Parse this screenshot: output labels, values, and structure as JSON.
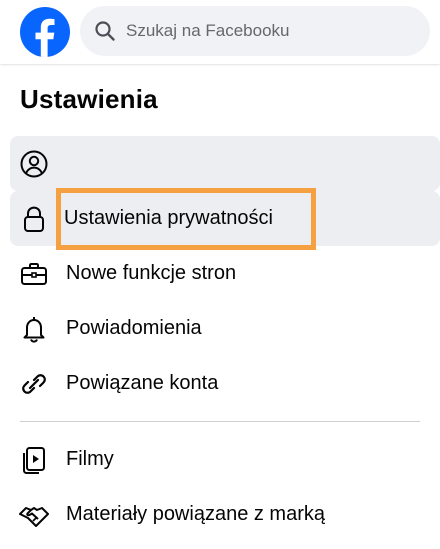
{
  "header": {
    "logo": "facebook-logo",
    "search": {
      "placeholder": "Szukaj na Facebooku",
      "icon": "search-icon"
    }
  },
  "page": {
    "title": "Ustawienia"
  },
  "menu": {
    "items": [
      {
        "label": "",
        "icon": "account-icon"
      },
      {
        "label": "Ustawienia prywatności",
        "icon": "lock-icon"
      },
      {
        "label": "Nowe funkcje stron",
        "icon": "briefcase-icon"
      },
      {
        "label": "Powiadomienia",
        "icon": "bell-icon"
      },
      {
        "label": "Powiązane konta",
        "icon": "link-icon"
      },
      {
        "label": "Filmy",
        "icon": "video-icon"
      },
      {
        "label": "Materiały powiązane z marką",
        "icon": "handshake-icon"
      }
    ]
  },
  "colors": {
    "brand": "#0866ff",
    "highlight_outline": "#f5a142",
    "item_background": "#eceef1",
    "search_background": "#f0f2f5"
  }
}
